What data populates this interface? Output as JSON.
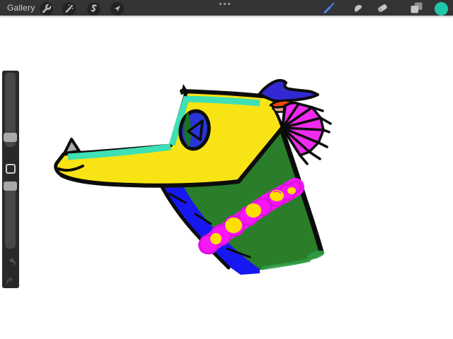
{
  "ui": {
    "topbar": {
      "gallery_label": "Gallery",
      "left_tools": [
        "actions-wrench",
        "adjustments-magic-wand",
        "selection-s",
        "transform-arrow"
      ],
      "center_tool": "more-options-ellipsis",
      "right_tools": [
        "paint-brush",
        "smudge-finger",
        "eraser",
        "layers",
        "color-swatch"
      ],
      "active_tool": "paint-brush"
    },
    "left_sidebar": {
      "controls": [
        "brush-size-slider",
        "modify-square-button",
        "opacity-slider",
        "undo-arrow",
        "redo-arrow"
      ]
    },
    "colors": {
      "topbar_bg": "#343436",
      "tool_circle_bg": "#232325",
      "icon_gray": "#bcbcbe",
      "gallery_text": "#d2d2d4",
      "active_brush_blue": "#4a8cf0",
      "current_color_swatch": "#1fc8a8",
      "sidebar_bg": "#29292b",
      "slider_track": "#47474a",
      "slider_handle": "#a9a9ab",
      "canvas_white": "#ffffff"
    }
  },
  "artwork": {
    "subject": "Cartoon dragon head facing left: yellow snout with teal stripe, blue-and-green eye, gray horn spike, blue head crest, orange ear slit, magenta fan frill, green neck with blue segmented belly band and magenta bead necklace with yellow gems",
    "palette": {
      "outline_black": "#0c0c0c",
      "snout_yellow": "#f8e414",
      "stripe_teal": "#3ee0b4",
      "eye_blue": "#2836d8",
      "eye_slit_green": "#157815",
      "horn_gray": "#ababab",
      "neck_green": "#2a7e2a",
      "neck_green_light": "#2f9e46",
      "belly_blue": "#1717f2",
      "crest_blue": "#3329d4",
      "ear_orange": "#f5470a",
      "ear_tan": "#dca87e",
      "frill_magenta": "#ee2bee",
      "necklace_magenta": "#f716f7",
      "necklace_outline": "#d911d9",
      "gem_yellow": "#ffdf00"
    }
  }
}
